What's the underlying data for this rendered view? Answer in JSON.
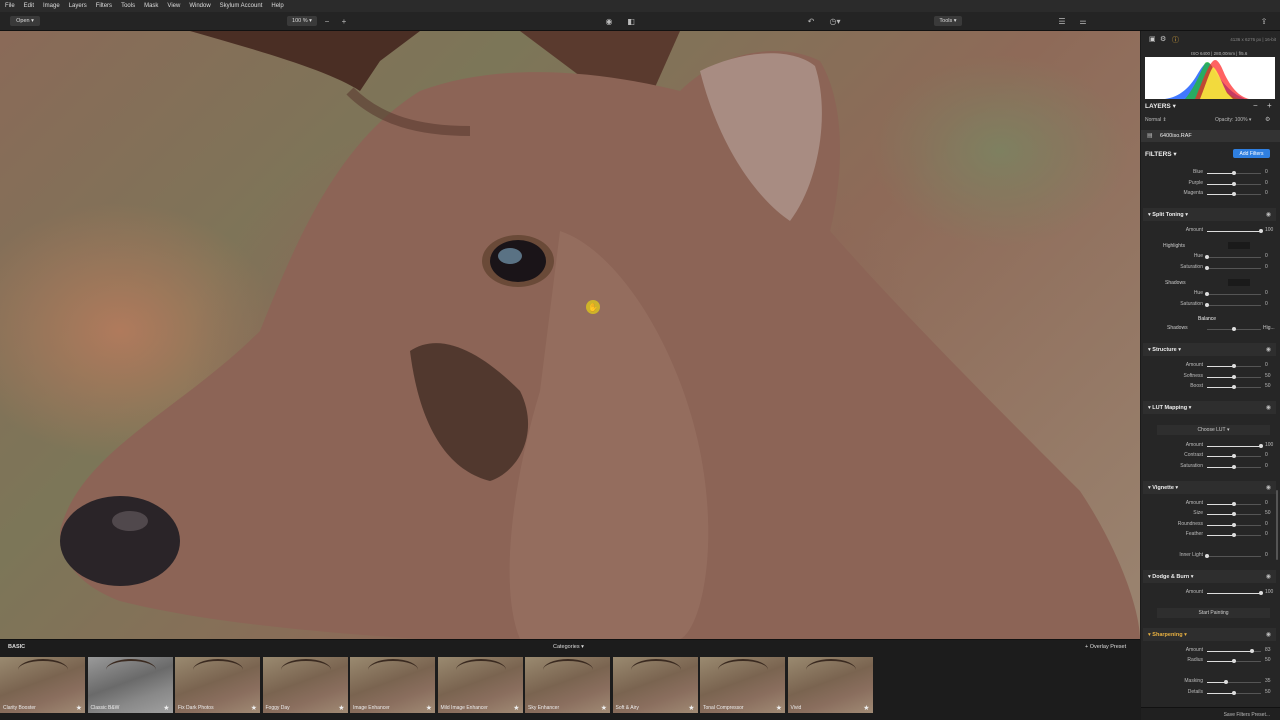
{
  "menu": [
    "File",
    "Edit",
    "Image",
    "Layers",
    "Filters",
    "Tools",
    "Mask",
    "View",
    "Window",
    "Skylum Account",
    "Help"
  ],
  "toolbar": {
    "open": "Open",
    "zoom": "100 %",
    "tools": "Tools"
  },
  "histogram": {
    "info_top": "4136 x 6276 px | 16-bit",
    "info_exif": "ISO 6400 | 280,00mm | f/5.6"
  },
  "layers": {
    "title": "LAYERS",
    "mode": "Normal",
    "opacity": "Opacity: 100%",
    "layer_name": "6400iso.RAF"
  },
  "filters": {
    "title": "FILTERS",
    "add_button": "Add Filters"
  },
  "color_rows": [
    {
      "label": "Blue",
      "val": "0",
      "pos": 0.5
    },
    {
      "label": "Purple",
      "val": "0",
      "pos": 0.5
    },
    {
      "label": "Magenta",
      "val": "0",
      "pos": 0.5
    }
  ],
  "split_toning": {
    "title": "Split Toning",
    "amount": {
      "label": "Amount",
      "val": "100",
      "pos": 1.0
    },
    "highlights": "Highlights",
    "h_hue": {
      "label": "Hue",
      "val": "0",
      "pos": 0.0
    },
    "h_sat": {
      "label": "Saturation",
      "val": "0",
      "pos": 0.0
    },
    "shadows": "Shadows",
    "s_hue": {
      "label": "Hue",
      "val": "0",
      "pos": 0.0
    },
    "s_sat": {
      "label": "Saturation",
      "val": "0",
      "pos": 0.0
    },
    "balance": "Balance",
    "bal_left": "Shadows",
    "bal_right": "Hig..."
  },
  "structure": {
    "title": "Structure",
    "rows": [
      {
        "label": "Amount",
        "val": "0",
        "pos": 0.5
      },
      {
        "label": "Softness",
        "val": "50",
        "pos": 0.5
      },
      {
        "label": "Boost",
        "val": "50",
        "pos": 0.5
      }
    ]
  },
  "lut": {
    "title": "LUT Mapping",
    "choose": "Choose LUT",
    "rows": [
      {
        "label": "Amount",
        "val": "100",
        "pos": 1.0
      },
      {
        "label": "Contrast",
        "val": "0",
        "pos": 0.5
      },
      {
        "label": "Saturation",
        "val": "0",
        "pos": 0.5
      }
    ]
  },
  "vignette": {
    "title": "Vignette",
    "rows": [
      {
        "label": "Amount",
        "val": "0",
        "pos": 0.5
      },
      {
        "label": "Size",
        "val": "50",
        "pos": 0.5
      },
      {
        "label": "Roundness",
        "val": "0",
        "pos": 0.5
      },
      {
        "label": "Feather",
        "val": "0",
        "pos": 0.5
      }
    ],
    "inner": {
      "label": "Inner Light",
      "val": "0",
      "pos": 0.0
    }
  },
  "dodge": {
    "title": "Dodge & Burn",
    "amount": {
      "label": "Amount",
      "val": "100",
      "pos": 1.0
    },
    "start": "Start Painting"
  },
  "sharpening": {
    "title": "Sharpening",
    "rows": [
      {
        "label": "Amount",
        "val": "83",
        "pos": 0.83
      },
      {
        "label": "Radius",
        "val": "50",
        "pos": 0.5
      }
    ],
    "rows2": [
      {
        "label": "Masking",
        "val": "35",
        "pos": 0.35
      },
      {
        "label": "Details",
        "val": "50",
        "pos": 0.5
      }
    ]
  },
  "save_presets": "Save Filters Preset...",
  "filmstrip": {
    "category": "BASIC",
    "categories": "Categories",
    "overlay": "+ Overlay Preset",
    "presets": [
      "Clarity Booster",
      "Classic B&W",
      "Fix Dark Photos",
      "Foggy Day",
      "Image Enhancer",
      "Mild Image Enhancer",
      "Sky Enhancer",
      "Soft & Airy",
      "Tonal Compressor",
      "Vivid"
    ]
  },
  "colors": {
    "accent": "#2f7fe0",
    "sharp_title": "#e8b040"
  }
}
